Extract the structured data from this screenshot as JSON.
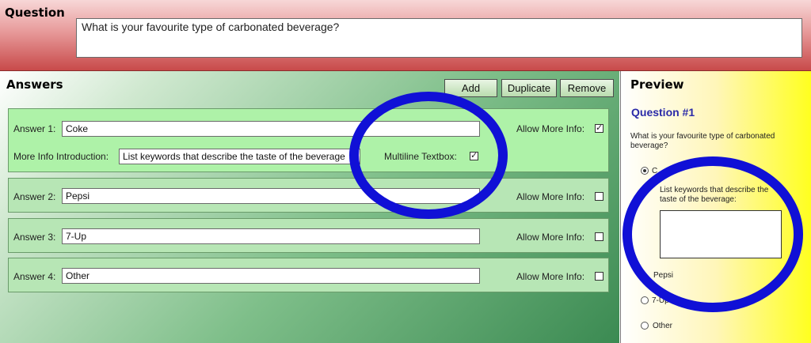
{
  "question": {
    "title": "Question",
    "text": "What is your favourite type of carbonated beverage?"
  },
  "answers": {
    "title": "Answers",
    "buttons": {
      "add": "Add",
      "duplicate": "Duplicate",
      "remove": "Remove"
    },
    "items": [
      {
        "label": "Answer 1:",
        "value": "Coke",
        "allow_label": "Allow More Info:",
        "allow_checked": "✓",
        "more_info_label": "More Info Introduction:",
        "more_info_value": "List keywords that describe the taste of the beverage",
        "multiline_label": "Multiline Textbox:",
        "multiline_checked": "✓"
      },
      {
        "label": "Answer 2:",
        "value": "Pepsi",
        "allow_label": "Allow More Info:",
        "allow_checked": ""
      },
      {
        "label": "Answer 3:",
        "value": "7-Up",
        "allow_label": "Allow More Info:",
        "allow_checked": ""
      },
      {
        "label": "Answer 4:",
        "value": "Other",
        "allow_label": "Allow More Info:",
        "allow_checked": ""
      }
    ]
  },
  "preview": {
    "title": "Preview",
    "question_number": "Question #1",
    "question_text": "What is your favourite type of carbonated beverage?",
    "option_1_partial": "C",
    "more_info_prompt": "List keywords that describe the taste of the beverage:",
    "option_2_partial": "Pepsi",
    "option_3_partial": "7-Up",
    "option_4": "Other"
  },
  "colors": {
    "ring": "#1010d6",
    "question_band": "#c84a4a",
    "answers_bg": "#3b8a52",
    "preview_bg": "#ffff1f",
    "preview_heading": "#2a2aa8"
  }
}
